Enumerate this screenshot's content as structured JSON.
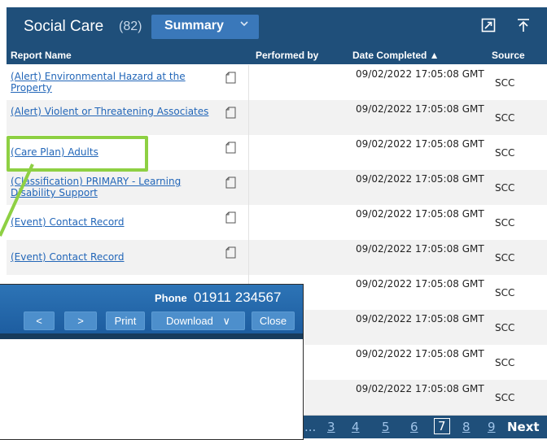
{
  "header": {
    "title": "Social Care",
    "count": "(82)",
    "view_select": "Summary",
    "chevron_icon": "chevron-down-icon",
    "expand_icon": "expand-icon",
    "scroll_top_icon": "scroll-to-top-icon"
  },
  "columns": {
    "report_name": "Report Name",
    "performed_by": "Performed by",
    "date_completed": "Date Completed ▲",
    "source": "Source"
  },
  "rows": [
    {
      "name": "(Alert) Environmental Hazard at the Property",
      "performed_by": "",
      "date": "09/02/2022 17:05:08 GMT",
      "source": "SCC"
    },
    {
      "name": "(Alert) Violent or Threatening Associates",
      "performed_by": "",
      "date": "09/02/2022 17:05:08 GMT",
      "source": "SCC"
    },
    {
      "name": "(Care Plan) Adults",
      "performed_by": "",
      "date": "09/02/2022 17:05:08 GMT",
      "source": "SCC"
    },
    {
      "name": "(Classification) PRIMARY - Learning Disability Support",
      "performed_by": "",
      "date": "09/02/2022 17:05:08 GMT",
      "source": "SCC"
    },
    {
      "name": "(Event) Contact Record",
      "performed_by": "",
      "date": "09/02/2022 17:05:08 GMT",
      "source": "SCC"
    },
    {
      "name": "(Event) Contact Record",
      "performed_by": "",
      "date": "09/02/2022 17:05:08 GMT",
      "source": "SCC"
    },
    {
      "name": "",
      "performed_by": "",
      "date": "09/02/2022 17:05:08 GMT",
      "source": "SCC"
    },
    {
      "name": "",
      "performed_by": "",
      "date": "09/02/2022 17:05:08 GMT",
      "source": "SCC"
    },
    {
      "name": "",
      "performed_by": "",
      "date": "09/02/2022 17:05:08 GMT",
      "source": "SCC"
    },
    {
      "name": "",
      "performed_by": "",
      "date": "09/02/2022 17:05:08 GMT",
      "source": "SCC"
    }
  ],
  "pagination": {
    "ellipsis": "...",
    "pages": [
      "3",
      "4",
      "5",
      "6",
      "7",
      "8",
      "9"
    ],
    "current": "7",
    "next": "Next"
  },
  "popup": {
    "phone_label": "Phone",
    "phone_value": "01911 234567",
    "buttons": {
      "prev": "<",
      "next": ">",
      "print": "Print",
      "download": "Download",
      "download_chevron": "∨",
      "close": "Close"
    }
  },
  "colors": {
    "header_bg": "#1f4f7a",
    "summary_bg": "#3a78ba",
    "link": "#2266b8",
    "callout": "#8ed043",
    "popup_bar": "#2d74b6"
  }
}
